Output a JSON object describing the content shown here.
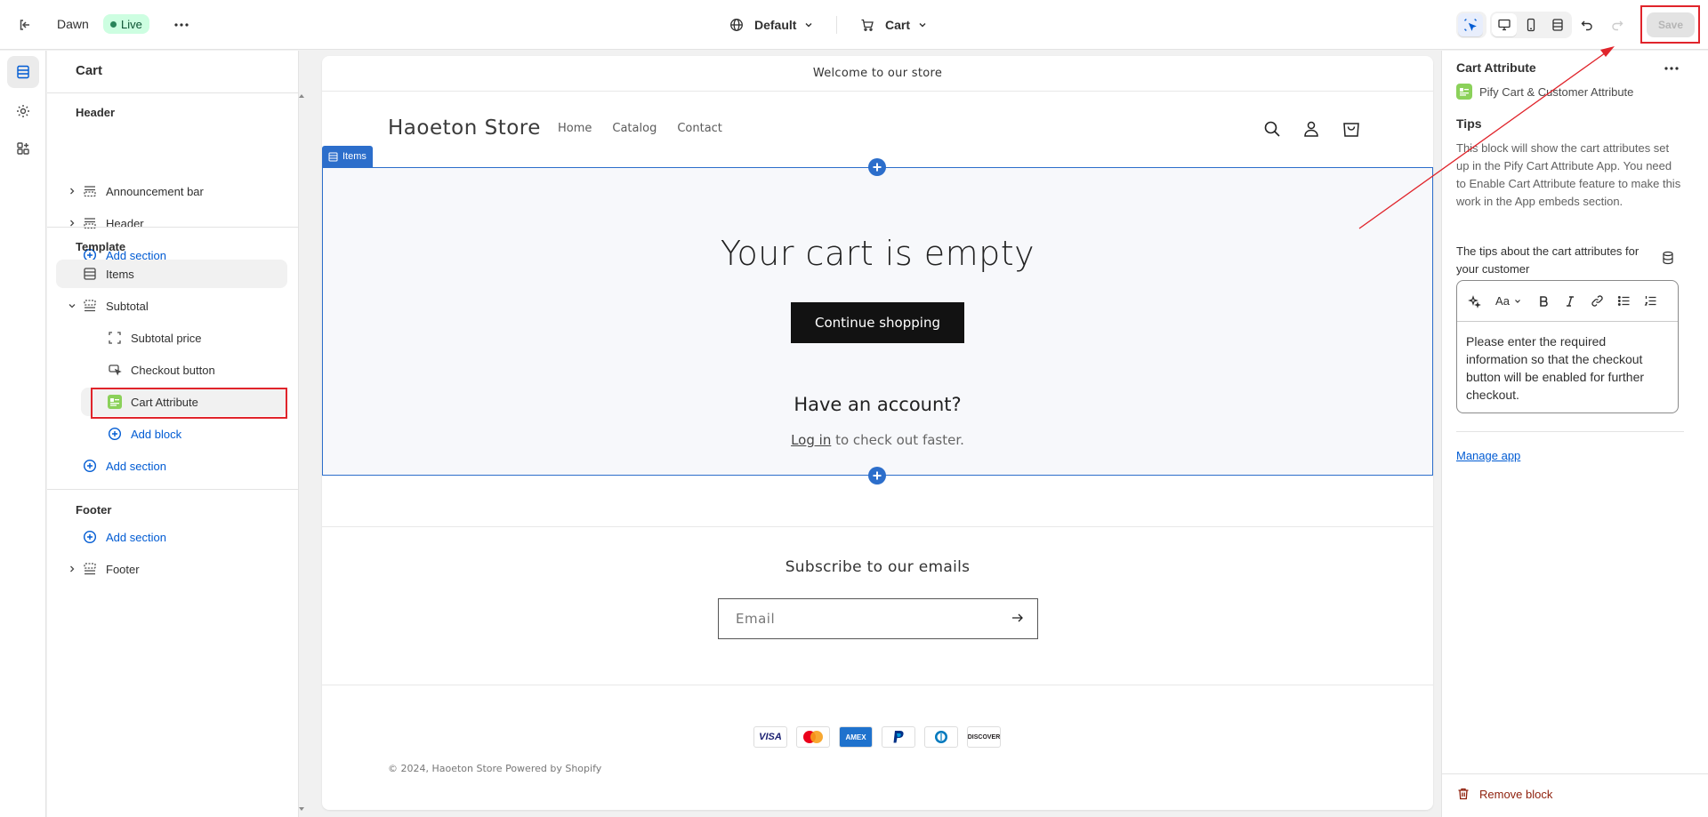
{
  "topbar": {
    "theme_name": "Dawn",
    "live_badge": "Live",
    "preview_locale": "Default",
    "template_name": "Cart",
    "save_label": "Save"
  },
  "sidebar": {
    "title": "Cart",
    "header_group": {
      "title": "Header",
      "items": [
        {
          "label": "Announcement bar"
        },
        {
          "label": "Header"
        }
      ],
      "add_section": "Add section"
    },
    "template_group": {
      "title": "Template",
      "items_label": "Items",
      "subtotal_label": "Subtotal",
      "blocks": [
        {
          "label": "Subtotal price"
        },
        {
          "label": "Checkout button"
        },
        {
          "label": "Cart Attribute"
        }
      ],
      "add_block": "Add block",
      "add_section": "Add section"
    },
    "footer_group": {
      "title": "Footer",
      "add_section": "Add section",
      "footer_label": "Footer"
    }
  },
  "preview": {
    "announcement": "Welcome to our store",
    "store_name": "Haoeton Store",
    "nav": [
      "Home",
      "Catalog",
      "Contact"
    ],
    "items_tag": "Items",
    "empty_title": "Your cart is empty",
    "continue_button": "Continue shopping",
    "have_account": "Have an account?",
    "login_link": "Log in",
    "login_suffix": " to check out faster.",
    "subscribe_title": "Subscribe to our emails",
    "email_placeholder": "Email",
    "payment_methods": [
      "VISA",
      "Mastercard",
      "AMEX",
      "PayPal",
      "Diners",
      "DISCOVER"
    ],
    "copyright_prefix": "© 2024, ",
    "copyright_store": "Haoeton Store",
    "copyright_powered": " Powered by Shopify"
  },
  "right_panel": {
    "title": "Cart Attribute",
    "app_name": "Pify Cart & Customer Attribute",
    "tips_heading": "Tips",
    "tips_text": "This block will show the cart attributes set up in the Pify Cart Attribute App. You need to Enable Cart Attribute feature to make this work in the App embeds section.",
    "field_label": "The tips about the cart attributes for your customer",
    "rte_value": "Please enter the required information so that the checkout button will be enabled for further checkout.",
    "manage_app": "Manage app",
    "remove_block": "Remove block"
  },
  "colors": {
    "accent_blue": "#005bd3",
    "selection_blue": "#2c6ecb",
    "annotation_red": "#e0242b",
    "live_green": "#29845a"
  }
}
